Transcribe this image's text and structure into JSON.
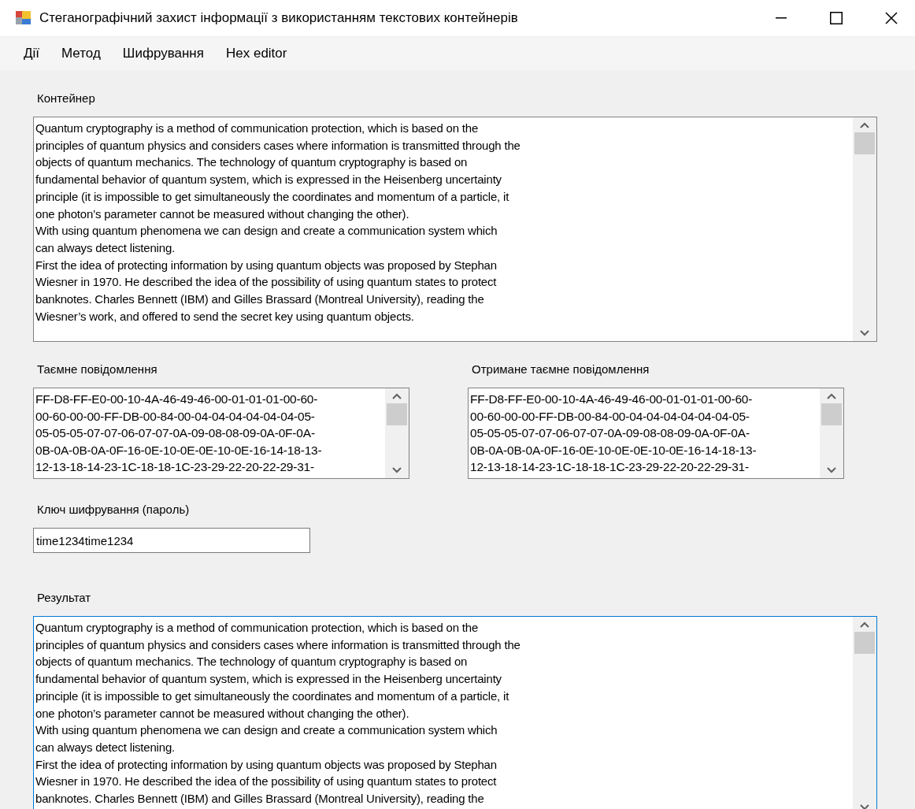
{
  "window": {
    "title": "Стеганографічний захист інформації з використанням текстових контейнерів"
  },
  "menu": [
    "Дії",
    "Метод",
    "Шифрування",
    "Hex editor"
  ],
  "container": {
    "label": "Контейнер",
    "lines": [
      "Quantum cryptography is a method of communication protection, which is based on the",
      "principles of quantum physics and considers cases where information is transmitted through the",
      "objects of quantum mechanics. The technology of quantum cryptography is based on",
      "fundamental behavior of quantum system, which is expressed in the Heisenberg uncertainty",
      "principle (it is impossible to get simultaneously the coordinates and momentum of a particle, it",
      "one photon’s parameter cannot be measured without changing the other).",
      "With using quantum phenomena we can design and create a communication system which",
      "can always detect listening.",
      "First the idea of protecting information by using quantum objects was proposed by Stephan",
      "Wiesner in 1970. He described the idea of the possibility of using quantum states to protect",
      "banknotes. Charles Bennett (IBM) and Gilles Brassard (Montreal University), reading the",
      "Wiesner’s work, and offered to send the secret key using quantum objects."
    ]
  },
  "secret": {
    "label": "Таємне повідомлення",
    "lines": [
      "FF-D8-FF-E0-00-10-4A-46-49-46-00-01-01-01-00-60-",
      "00-60-00-00-FF-DB-00-84-00-04-04-04-04-04-04-05-",
      "05-05-05-07-07-06-07-07-0A-09-08-08-09-0A-0F-0A-",
      "0B-0A-0B-0A-0F-16-0E-10-0E-0E-10-0E-16-14-18-13-",
      "12-13-18-14-23-1C-18-18-1C-23-29-22-20-22-29-31-"
    ]
  },
  "received": {
    "label": "Отримане таємне повідомлення",
    "lines": [
      "FF-D8-FF-E0-00-10-4A-46-49-46-00-01-01-01-00-60-",
      "00-60-00-00-FF-DB-00-84-00-04-04-04-04-04-04-05-",
      "05-05-05-07-07-06-07-07-0A-09-08-08-09-0A-0F-0A-",
      "0B-0A-0B-0A-0F-16-0E-10-0E-0E-10-0E-16-14-18-13-",
      "12-13-18-14-23-1C-18-18-1C-23-29-22-20-22-29-31-"
    ]
  },
  "key": {
    "label": "Ключ шифрування (пароль)",
    "value": "time1234time1234"
  },
  "result": {
    "label": "Результат",
    "focused": true,
    "lines": [
      "Quantum cryptography is a method of communication protection, which is based on the",
      "principles of quantum physics and considers cases where information is transmitted through the",
      "objects of quantum mechanics. The technology of quantum cryptography is based on",
      "fundamental behavior of quantum system, which is expressed in the Heisenberg uncertainty",
      "principle (it is impossible to get simultaneously the coordinates and momentum of a particle, it",
      "one photon’s parameter cannot be measured without changing the other).",
      "With using quantum phenomena we can design and create a communication system which",
      "can always detect listening.",
      "First the idea of protecting information by using quantum objects was proposed by Stephan",
      "Wiesner in 1970. He described the idea of the possibility of using quantum states to protect",
      "banknotes. Charles Bennett (IBM) and Gilles Brassard (Montreal University), reading the"
    ]
  }
}
